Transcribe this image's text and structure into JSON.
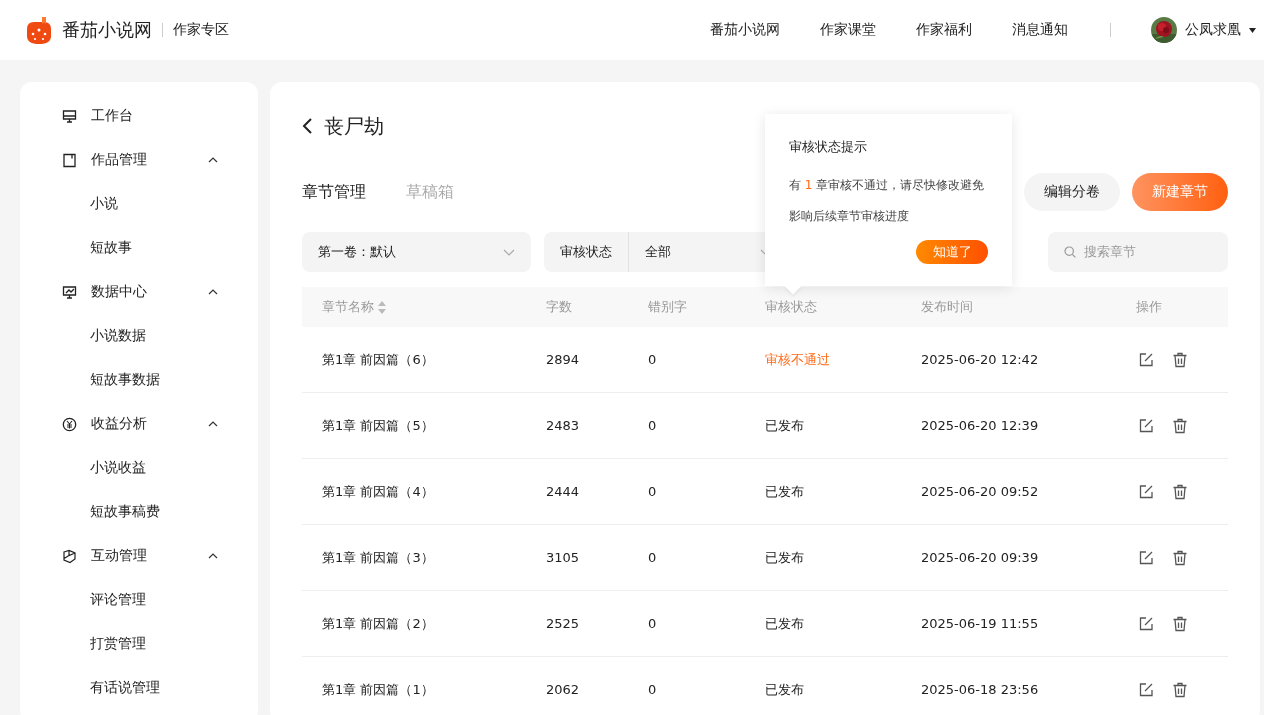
{
  "header": {
    "site_name": "番茄小说网",
    "section": "作家专区",
    "nav": [
      "番茄小说网",
      "作家课堂",
      "作家福利",
      "消息通知"
    ],
    "user": {
      "name": "公凤求凰"
    }
  },
  "sidebar": {
    "items": [
      {
        "label": "工作台",
        "kind": "desk",
        "selected": false
      },
      {
        "label": "作品管理",
        "kind": "book",
        "expanded": true,
        "selected": false,
        "children": [
          {
            "label": "小说",
            "selected": false
          },
          {
            "label": "短故事",
            "selected": false
          }
        ]
      },
      {
        "label": "数据中心",
        "kind": "chart",
        "expanded": true,
        "selected": false,
        "children": [
          {
            "label": "小说数据",
            "selected": false
          },
          {
            "label": "短故事数据",
            "selected": false
          }
        ]
      },
      {
        "label": "收益分析",
        "kind": "coin",
        "expanded": true,
        "selected": false,
        "children": [
          {
            "label": "小说收益",
            "selected": false
          },
          {
            "label": "短故事稿费",
            "selected": false
          }
        ]
      },
      {
        "label": "互动管理",
        "kind": "chat",
        "expanded": true,
        "selected": false,
        "children": [
          {
            "label": "评论管理",
            "selected": false
          },
          {
            "label": "打赏管理",
            "selected": false
          },
          {
            "label": "有话说管理",
            "selected": false
          }
        ]
      }
    ]
  },
  "book": {
    "title": "丧尸劫"
  },
  "tabs": [
    {
      "label": "章节管理",
      "selected": true
    },
    {
      "label": "草稿箱",
      "selected": false
    }
  ],
  "buttons": [
    {
      "label": "编辑分卷",
      "kind": "secondary"
    },
    {
      "label": "新建章节",
      "kind": "primary"
    }
  ],
  "filters": {
    "volume": "第一卷：默认",
    "status_label": "审核状态",
    "status_value": "全部",
    "search_placeholder": "搜索章节"
  },
  "tooltip": {
    "title": "审核状态提示",
    "message_prefix": "有",
    "count": "1",
    "message_suffix": "章审核不通过，请尽快修改避免影响后续章节审核进度",
    "button": "知道了"
  },
  "table": {
    "columns": [
      "章节名称",
      "字数",
      "错别字",
      "审核状态",
      "发布时间",
      "操作"
    ],
    "rows": [
      {
        "name": "第1章 前因篇（6）",
        "words": "2894",
        "typos": "0",
        "status": "审核不通过",
        "kind": "rejected",
        "time": "2025-06-20 12:42"
      },
      {
        "name": "第1章 前因篇（5）",
        "words": "2483",
        "typos": "0",
        "status": "已发布",
        "kind": "published",
        "time": "2025-06-20 12:39"
      },
      {
        "name": "第1章 前因篇（4）",
        "words": "2444",
        "typos": "0",
        "status": "已发布",
        "kind": "published",
        "time": "2025-06-20 09:52"
      },
      {
        "name": "第1章 前因篇（3）",
        "words": "3105",
        "typos": "0",
        "status": "已发布",
        "kind": "published",
        "time": "2025-06-20 09:39"
      },
      {
        "name": "第1章 前因篇（2）",
        "words": "2525",
        "typos": "0",
        "status": "已发布",
        "kind": "published",
        "time": "2025-06-19 11:55"
      },
      {
        "name": "第1章 前因篇（1）",
        "words": "2062",
        "typos": "0",
        "status": "已发布",
        "kind": "published",
        "time": "2025-06-18 23:56"
      }
    ]
  }
}
